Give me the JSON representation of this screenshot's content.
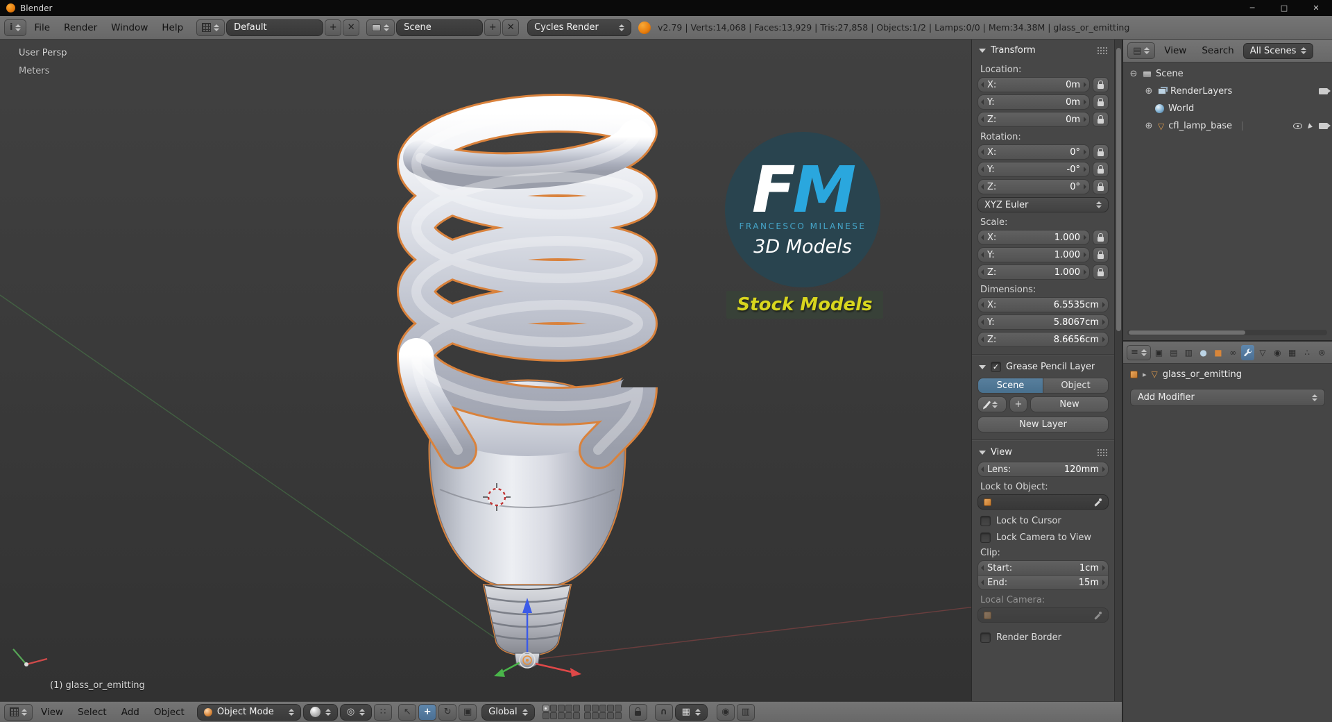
{
  "window": {
    "title": "Blender",
    "minimize": "─",
    "maximize": "□",
    "close": "✕"
  },
  "topbar": {
    "menus": [
      "File",
      "Render",
      "Window",
      "Help"
    ],
    "layout_name": "Default",
    "scene_name": "Scene",
    "engine": "Cycles Render",
    "add_label": "+",
    "unlink_label": "✕",
    "stats": "v2.79 | Verts:14,068 | Faces:13,929 | Tris:27,858 | Objects:1/2 | Lamps:0/0 | Mem:34.38M | glass_or_emitting"
  },
  "viewport": {
    "view_label": "User Persp",
    "units_label": "Meters",
    "object_label": "(1) glass_or_emitting",
    "logo": {
      "f": "F",
      "m": "M",
      "name": "FRANCESCO MILANESE",
      "models": "3D Models",
      "stock": "Stock Models"
    }
  },
  "npanel": {
    "transform": {
      "title": "Transform",
      "location_label": "Location:",
      "rotation_label": "Rotation:",
      "scale_label": "Scale:",
      "dimensions_label": "Dimensions:",
      "rotation_mode": "XYZ Euler",
      "location": {
        "x_label": "X:",
        "x": "0m",
        "y_label": "Y:",
        "y": "0m",
        "z_label": "Z:",
        "z": "0m"
      },
      "rotation": {
        "x_label": "X:",
        "x": "0°",
        "y_label": "Y:",
        "y": "-0°",
        "z_label": "Z:",
        "z": "0°"
      },
      "scale": {
        "x_label": "X:",
        "x": "1.000",
        "y_label": "Y:",
        "y": "1.000",
        "z_label": "Z:",
        "z": "1.000"
      },
      "dimensions": {
        "x_label": "X:",
        "x": "6.5535cm",
        "y_label": "Y:",
        "y": "5.8067cm",
        "z_label": "Z:",
        "z": "8.6656cm"
      }
    },
    "grease": {
      "title": "Grease Pencil Layer",
      "tab_scene": "Scene",
      "tab_object": "Object",
      "new_label": "New",
      "new_layer_label": "New Layer"
    },
    "view": {
      "title": "View",
      "lens_label": "Lens:",
      "lens_value": "120mm",
      "lock_object_label": "Lock to Object:",
      "lock_cursor_label": "Lock to Cursor",
      "lock_camera_label": "Lock Camera to View",
      "clip_label": "Clip:",
      "clip_start_label": "Start:",
      "clip_start": "1cm",
      "clip_end_label": "End:",
      "clip_end": "15m",
      "local_camera_label": "Local Camera:",
      "render_border_label": "Render Border"
    }
  },
  "outliner": {
    "menu_view": "View",
    "menu_search": "Search",
    "scenes_filter": "All Scenes",
    "items": [
      {
        "label": "Scene"
      },
      {
        "label": "RenderLayers"
      },
      {
        "label": "World"
      },
      {
        "label": "cfl_lamp_base"
      }
    ]
  },
  "properties": {
    "breadcrumb": "glass_or_emitting",
    "add_modifier": "Add Modifier"
  },
  "bottombar": {
    "menus": [
      "View",
      "Select",
      "Add",
      "Object"
    ],
    "mode": "Object Mode",
    "orientation": "Global"
  },
  "colors": {
    "accent_blue": "#4b6f93",
    "selection_orange": "#d9823c",
    "axis_red": "#e04848",
    "axis_green": "#4ab54a",
    "axis_blue": "#3c5be8"
  }
}
